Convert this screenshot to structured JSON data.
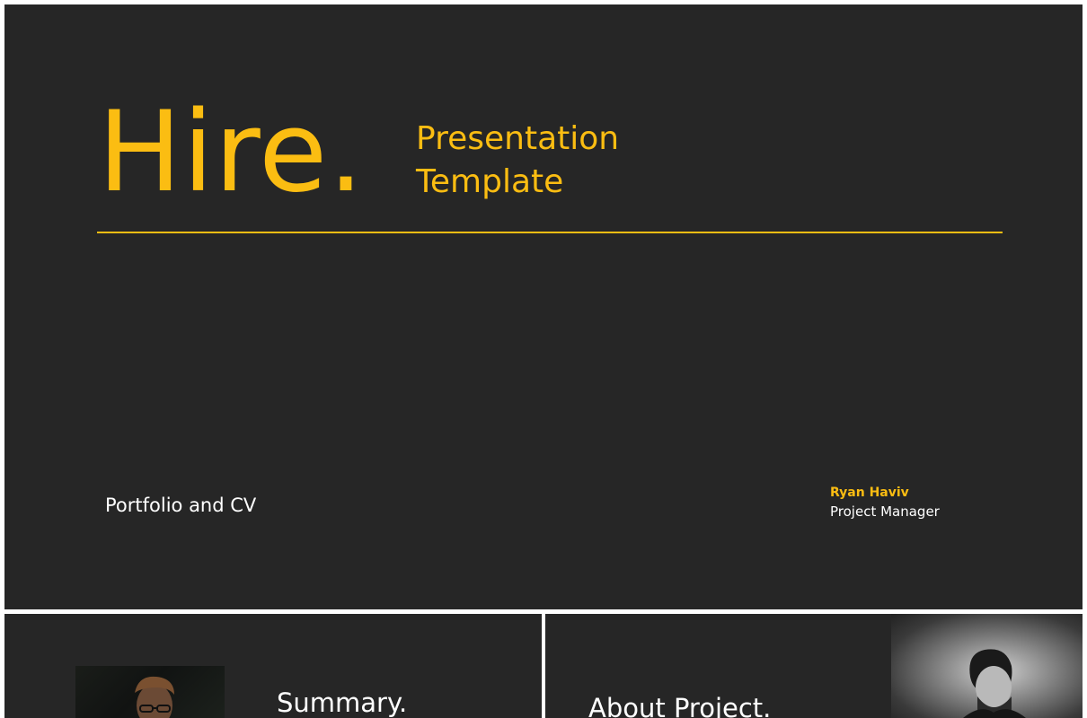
{
  "title_slide": {
    "title": "Hire.",
    "subtitle_line1": "Presentation",
    "subtitle_line2": "Template",
    "footer_label": "Portfolio and CV",
    "author_name": "Ryan Haviv",
    "author_role": "Project Manager"
  },
  "summary_slide": {
    "title": "Summary."
  },
  "about_slide": {
    "title": "About Project."
  },
  "colors": {
    "background": "#262626",
    "accent": "#fbbd12",
    "text": "#ffffff"
  }
}
